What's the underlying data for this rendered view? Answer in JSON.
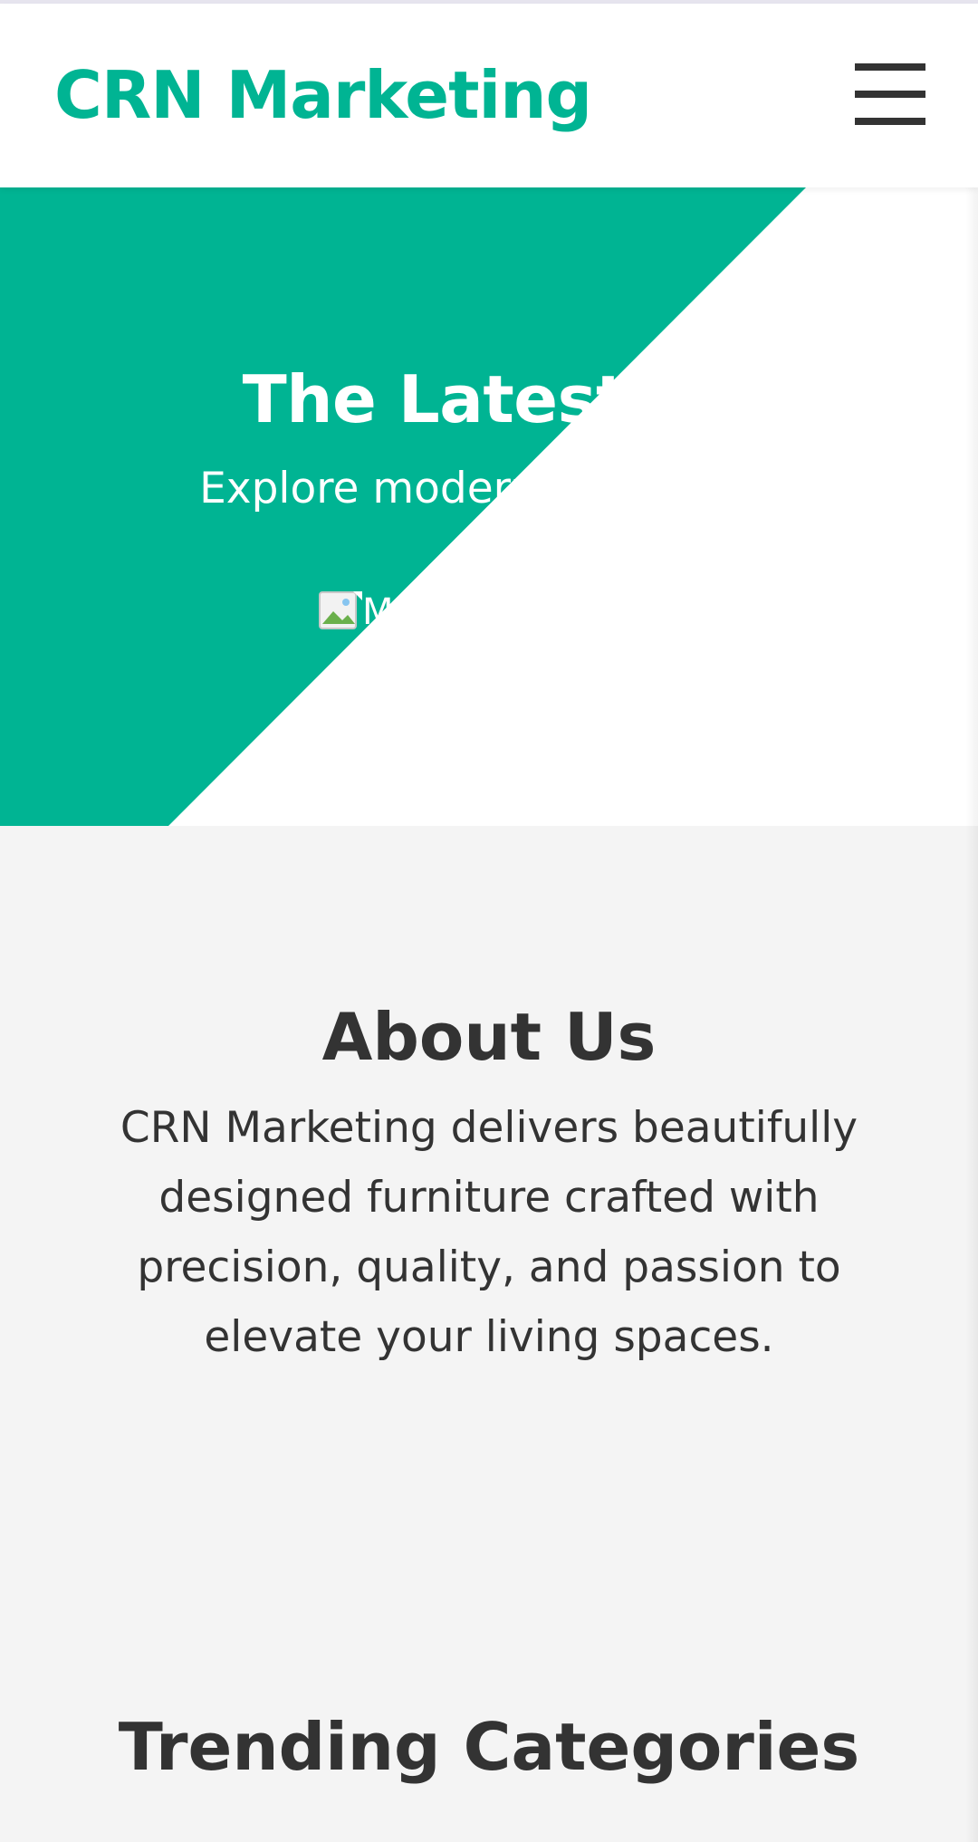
{
  "header": {
    "brand": "CRN Marketing",
    "menu_icon": "hamburger-menu-icon"
  },
  "hero": {
    "title": "The Latest Fu",
    "subtitle": "Explore modern and match",
    "image_icon": "broken-image-icon",
    "image_alt": "M",
    "colors": {
      "accent": "#00b493",
      "diagonal_overlay": "#ffffff"
    }
  },
  "about": {
    "title": "About Us",
    "text": "CRN Marketing delivers beautifully designed furniture crafted with precision, quality, and passion to elevate your living spaces."
  },
  "trending": {
    "title": "Trending Categories"
  },
  "colors": {
    "brand": "#00b493",
    "text": "#333333",
    "background": "#f4f4f4"
  }
}
